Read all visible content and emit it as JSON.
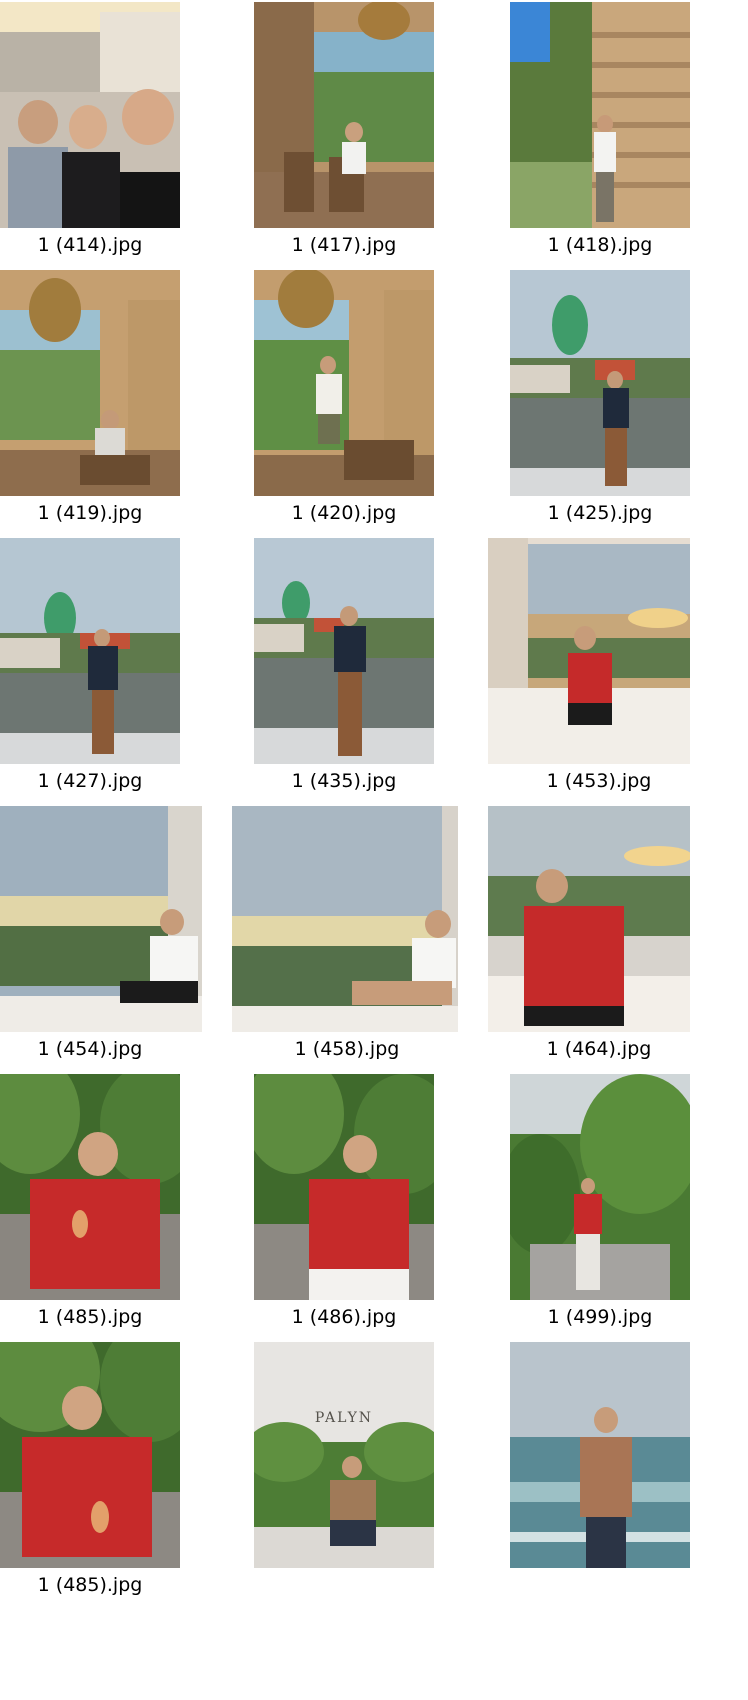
{
  "items": [
    {
      "filename": "1 (414).jpg",
      "scene": "street-selfie"
    },
    {
      "filename": "1 (417).jpg",
      "scene": "cafe-window"
    },
    {
      "filename": "1 (418).jpg",
      "scene": "wall-garden"
    },
    {
      "filename": "1 (419).jpg",
      "scene": "cafe-window"
    },
    {
      "filename": "1 (420).jpg",
      "scene": "cafe-window"
    },
    {
      "filename": "1 (425).jpg",
      "scene": "river-boat"
    },
    {
      "filename": "1 (427).jpg",
      "scene": "river-boat"
    },
    {
      "filename": "1 (435).jpg",
      "scene": "river-boat"
    },
    {
      "filename": "1 (453).jpg",
      "scene": "sunset-window"
    },
    {
      "filename": "1 (454).jpg",
      "scene": "sunset-window"
    },
    {
      "filename": "1 (458).jpg",
      "scene": "sunset-window"
    },
    {
      "filename": "1 (464).jpg",
      "scene": "sunset-window"
    },
    {
      "filename": "1 (485).jpg",
      "scene": "garden-red-shirt"
    },
    {
      "filename": "1 (486).jpg",
      "scene": "garden-red-shirt"
    },
    {
      "filename": "1 (499).jpg",
      "scene": "garden-path"
    },
    {
      "filename": "1 (485).jpg",
      "scene": "garden-red-shirt"
    },
    {
      "filename": "",
      "scene": "palyn-wall",
      "sign": "PALYN"
    },
    {
      "filename": "",
      "scene": "sea-view"
    }
  ]
}
